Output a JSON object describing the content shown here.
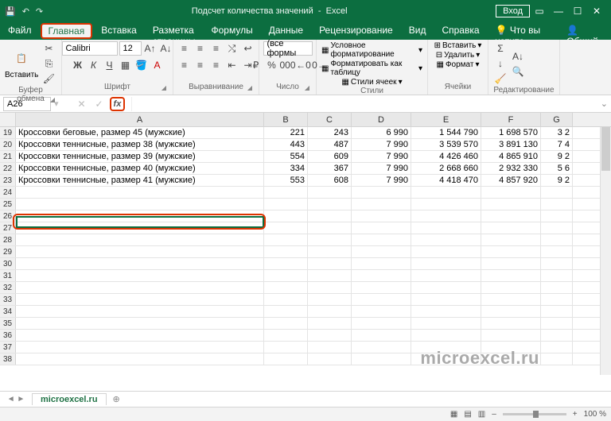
{
  "title": "Подсчет количества значений",
  "app": "Excel",
  "login": "Вход",
  "share": "Общий доступ",
  "tabs": [
    "Файл",
    "Главная",
    "Вставка",
    "Разметка страницы",
    "Формулы",
    "Данные",
    "Рецензирование",
    "Вид",
    "Справка"
  ],
  "tell_me": "Что вы хотите сделать?",
  "ribbon": {
    "paste": "Вставить",
    "clipboard": "Буфер обмена",
    "font": "Шрифт",
    "font_name": "Calibri",
    "font_size": "12",
    "alignment": "Выравнивание",
    "number": "Число",
    "number_format": "(все формы",
    "styles": "Стили",
    "style_items": [
      "Условное форматирование",
      "Форматировать как таблицу",
      "Стили ячеек"
    ],
    "cells": "Ячейки",
    "cell_items": [
      "Вставить",
      "Удалить",
      "Формат"
    ],
    "editing": "Редактирование"
  },
  "namebox": "A26",
  "columns": [
    "A",
    "B",
    "C",
    "D",
    "E",
    "F",
    "G"
  ],
  "row_start": 19,
  "data_rows": [
    {
      "a": "Кроссовки беговые, размер 45 (мужские)",
      "b": "221",
      "c": "243",
      "d": "6 990",
      "e": "1 544 790",
      "f": "1 698 570",
      "g": "3 2"
    },
    {
      "a": "Кроссовки теннисные, размер 38 (мужские)",
      "b": "443",
      "c": "487",
      "d": "7 990",
      "e": "3 539 570",
      "f": "3 891 130",
      "g": "7 4"
    },
    {
      "a": "Кроссовки теннисные, размер 39 (мужские)",
      "b": "554",
      "c": "609",
      "d": "7 990",
      "e": "4 426 460",
      "f": "4 865 910",
      "g": "9 2"
    },
    {
      "a": "Кроссовки теннисные, размер 40 (мужские)",
      "b": "334",
      "c": "367",
      "d": "7 990",
      "e": "2 668 660",
      "f": "2 932 330",
      "g": "5 6"
    },
    {
      "a": "Кроссовки теннисные, размер 41 (мужские)",
      "b": "553",
      "c": "608",
      "d": "7 990",
      "e": "4 418 470",
      "f": "4 857 920",
      "g": "9 2"
    }
  ],
  "empty_rows": 15,
  "sheet": "microexcel.ru",
  "zoom": "100 %",
  "watermark": "microexcel.ru"
}
